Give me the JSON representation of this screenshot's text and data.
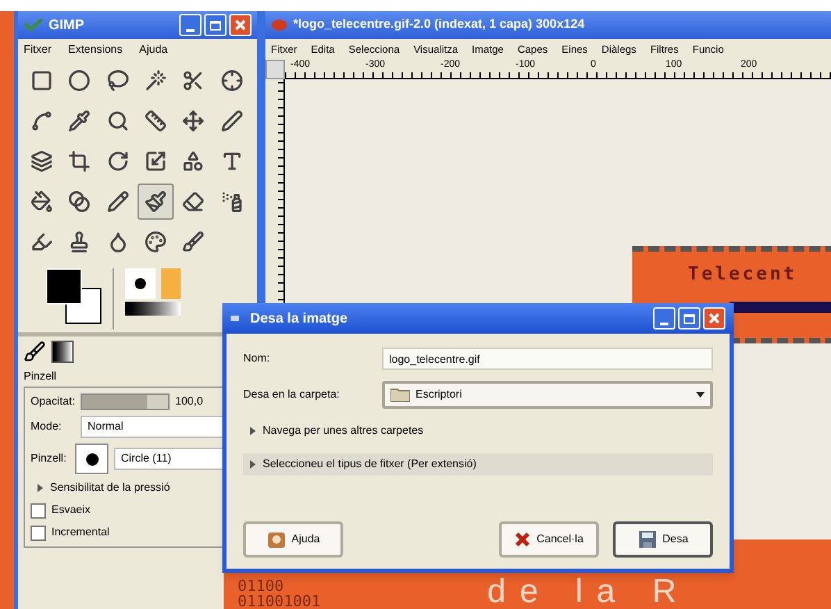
{
  "toolbox": {
    "title": "GIMP",
    "menu": [
      "Fitxer",
      "Extensions",
      "Ajuda"
    ],
    "tools": [
      {
        "selected": false
      },
      {
        "selected": false
      },
      {
        "selected": false
      },
      {
        "selected": false
      },
      {
        "selected": false
      },
      {
        "selected": false
      },
      {
        "selected": false
      },
      {
        "selected": false
      },
      {
        "selected": false
      },
      {
        "selected": false
      },
      {
        "selected": false
      },
      {
        "selected": false
      },
      {
        "selected": false
      },
      {
        "selected": false
      },
      {
        "selected": false
      },
      {
        "selected": false
      },
      {
        "selected": false
      },
      {
        "selected": false
      },
      {
        "selected": false
      },
      {
        "selected": false
      },
      {
        "selected": false
      },
      {
        "selected": true
      },
      {
        "selected": false
      },
      {
        "selected": false
      },
      {
        "selected": false
      },
      {
        "selected": false
      },
      {
        "selected": false
      },
      {
        "selected": false
      },
      {
        "selected": false
      }
    ],
    "options": {
      "tool_name": "Pinzell",
      "opacity_label": "Opacitat:",
      "opacity": {
        "level": 0.75
      },
      "opacity_value": "100,0",
      "mode_label": "Mode:",
      "mode": "Normal",
      "brush_label": "Pinzell:",
      "brush": "Circle (11)",
      "pressure": {
        "label": "Sensibilitat de la pressió",
        "expanded": false
      },
      "checkboxes": [
        {
          "label": "Esvaeix",
          "checked": false
        },
        {
          "label": "Incremental",
          "checked": false
        }
      ]
    }
  },
  "image_window": {
    "title": "*logo_telecentre.gif-2.0 (indexat, 1 capa) 300x124",
    "menu": [
      "Fitxer",
      "Edita",
      "Selecciona",
      "Visualitza",
      "Imatge",
      "Capes",
      "Eines",
      "Diàlegs",
      "Filtres",
      "Funcio"
    ],
    "ruler_labels": [
      "-400",
      "-300",
      "-200",
      "-100",
      "0",
      "100",
      "200"
    ],
    "logo_text": "Telecent",
    "banner_text": "de la R",
    "binary_lines": [
      "01100",
      "011001001"
    ]
  },
  "dialog": {
    "title": "Desa la imatge",
    "name_label": "Nom:",
    "name_value": "logo_telecentre.gif",
    "folder_label": "Desa en la carpeta:",
    "folder": "Escriptori",
    "expanders": [
      {
        "label": "Navega per unes altres carpetes",
        "expanded": false,
        "highlighted": false
      },
      {
        "label": "Seleccioneu el tipus de fitxer (Per extensió)",
        "expanded": false,
        "highlighted": true
      }
    ],
    "buttons": [
      {
        "kind": "help",
        "label": "Ajuda"
      },
      {
        "kind": "cancel",
        "label": "Cancel·la"
      },
      {
        "kind": "save",
        "label": "Desa"
      }
    ]
  }
}
